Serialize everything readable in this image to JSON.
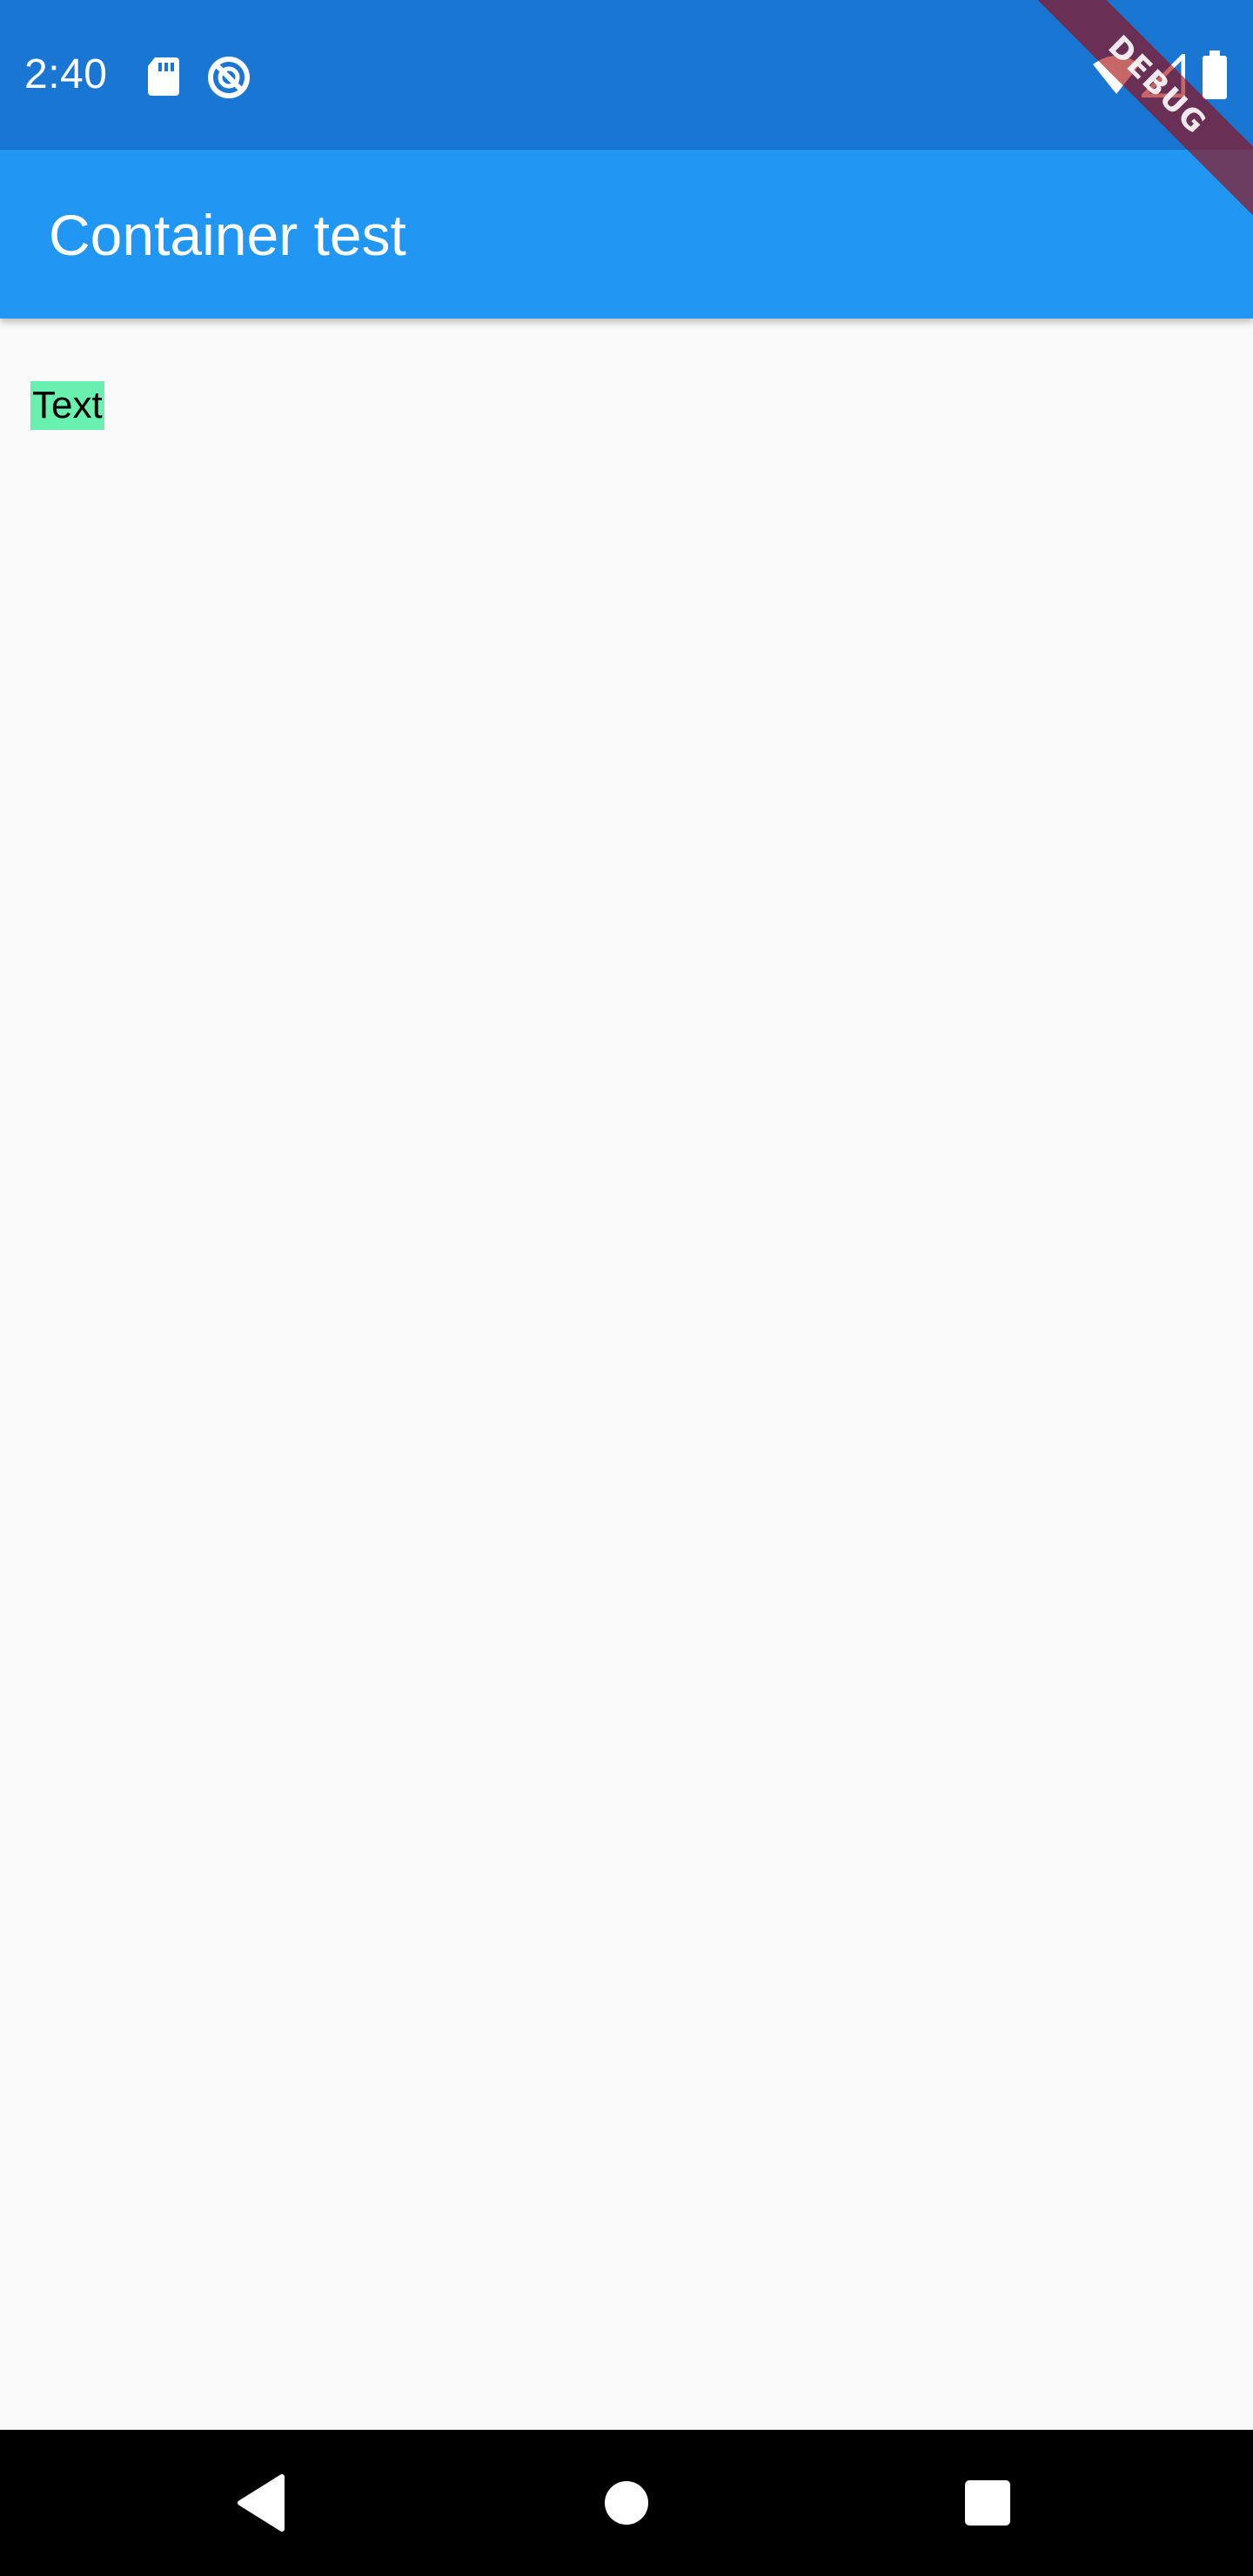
{
  "status_bar": {
    "time": "2:40",
    "left_icons": [
      "sd-card-icon",
      "data-saver-icon"
    ],
    "right_icons": [
      "wifi-icon",
      "cell-signal-icon",
      "battery-icon"
    ],
    "background": "#1976d2"
  },
  "app_bar": {
    "title": "Container test",
    "background": "#2196f3"
  },
  "content": {
    "text": "Text",
    "text_background": "#69f0ae"
  },
  "debug_banner": {
    "label": "DEBUG"
  },
  "nav_bar": {
    "buttons": [
      "back-icon",
      "home-icon",
      "recents-icon"
    ]
  }
}
